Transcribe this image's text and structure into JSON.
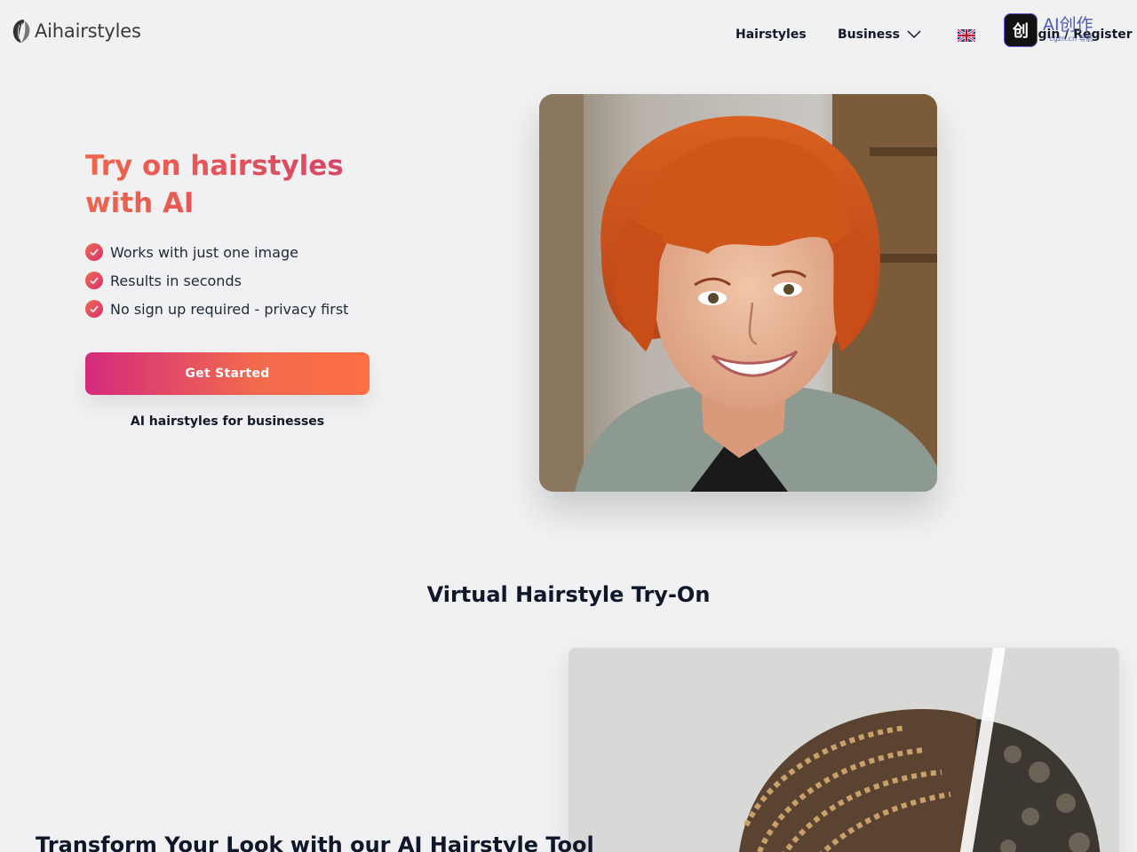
{
  "header": {
    "logo_text": "Aihairstyles",
    "nav": {
      "hairstyles": "Hairstyles",
      "business": "Business"
    },
    "language_icon": "uk-flag-icon",
    "login_label": "Login / Register",
    "watermark": {
      "text": "AI创作",
      "sub": "cgzn.cn 导航"
    }
  },
  "hero": {
    "title": "Try on hairstyles with AI",
    "features": [
      "Works with just one image",
      "Results in seconds",
      "No sign up required - privacy first"
    ],
    "cta_label": "Get Started",
    "business_link": "AI hairstyles for businesses"
  },
  "section2": {
    "title": "Virtual Hairstyle Try-On",
    "heading": "Transform Your Look with our AI Hairstyle Tool"
  },
  "colors": {
    "background": "#f1f1f3",
    "accent_start": "#d42a7d",
    "accent_end": "#ff6f45",
    "text_dark": "#111827"
  }
}
